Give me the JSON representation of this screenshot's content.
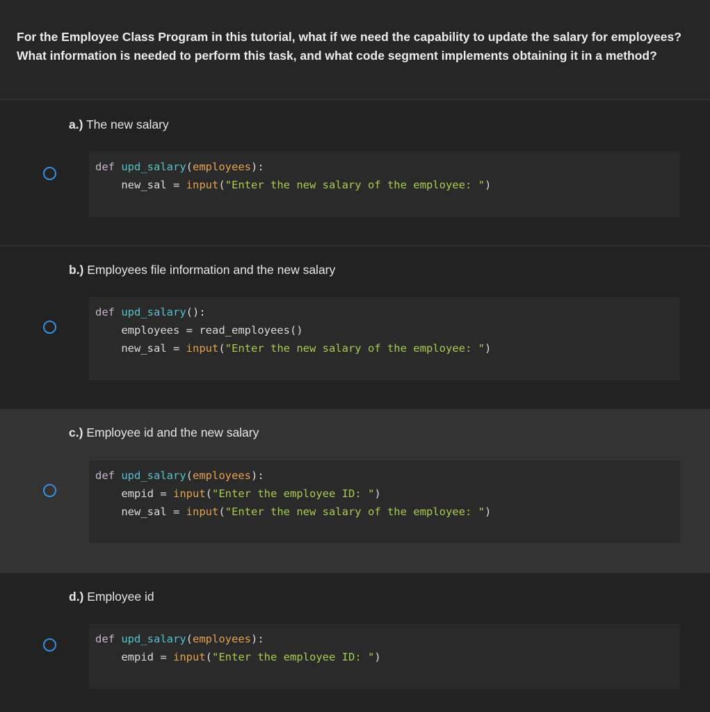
{
  "question": {
    "line1": "For the Employee Class Program in this tutorial, what if we need the capability to update the salary for employees?",
    "line2": "What information is needed to perform this task, and what code segment implements obtaining it in a method?"
  },
  "accent_color": "#3a8fd9",
  "options": [
    {
      "letter": "a.)",
      "label": "The new salary",
      "selected": false,
      "code": {
        "def": "def",
        "fn": "upd_salary",
        "open": "(",
        "param": "employees",
        "close": "):",
        "lines": [
          {
            "var": "new_sal",
            "eq": " = ",
            "call": "input",
            "open": "(",
            "str": "\"Enter the new salary of the employee: \"",
            "close": ")"
          }
        ]
      }
    },
    {
      "letter": "b.)",
      "label": "Employees file information and the new salary",
      "selected": false,
      "code": {
        "def": "def",
        "fn": "upd_salary",
        "open": "(",
        "param": "",
        "close": "):",
        "lines": [
          {
            "var": "employees",
            "eq": " = ",
            "plain": "read_employees()"
          },
          {
            "var": "new_sal",
            "eq": " = ",
            "call": "input",
            "open": "(",
            "str": "\"Enter the new salary of the employee: \"",
            "close": ")"
          }
        ]
      }
    },
    {
      "letter": "c.)",
      "label": "Employee id and the new salary",
      "selected": false,
      "code": {
        "def": "def",
        "fn": "upd_salary",
        "open": "(",
        "param": "employees",
        "close": "):",
        "lines": [
          {
            "var": "empid",
            "eq": " = ",
            "call": "input",
            "open": "(",
            "str": "\"Enter the employee ID: \"",
            "close": ")"
          },
          {
            "var": "new_sal",
            "eq": " = ",
            "call": "input",
            "open": "(",
            "str": "\"Enter the new salary of the employee: \"",
            "close": ")"
          }
        ]
      }
    },
    {
      "letter": "d.)",
      "label": "Employee id",
      "selected": false,
      "code": {
        "def": "def",
        "fn": "upd_salary",
        "open": "(",
        "param": "employees",
        "close": "):",
        "lines": [
          {
            "var": "empid",
            "eq": " = ",
            "call": "input",
            "open": "(",
            "str": "\"Enter the employee ID: \"",
            "close": ")"
          }
        ]
      }
    }
  ]
}
